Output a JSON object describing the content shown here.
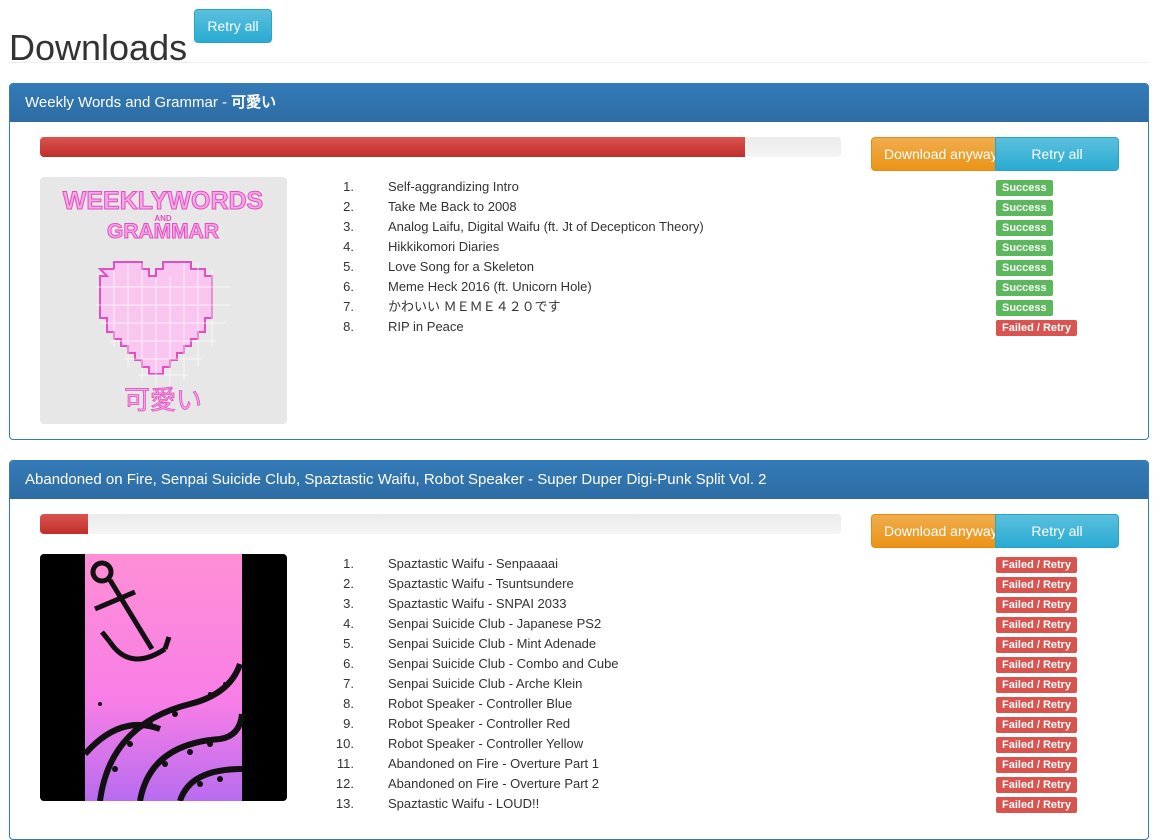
{
  "page": {
    "title": "Downloads",
    "retry_all_label": "Retry all"
  },
  "colors": {
    "primary": "#337ab7",
    "success": "#5cb85c",
    "danger": "#d9534f",
    "warning": "#f0ad4e",
    "info": "#5bc0de"
  },
  "albums": [
    {
      "heading_prefix": "Weekly Words and Grammar - ",
      "heading_suffix": "可愛い",
      "progress_percent": 88,
      "download_anyway_label": "Download anyway",
      "retry_all_label": "Retry all",
      "cover_text_top": "WEEKLYWORDS",
      "cover_text_and": "AND",
      "cover_text_mid": "GRAMMAR",
      "cover_text_bottom": "可愛い",
      "tracks": [
        {
          "num": "1.",
          "title": "Self-aggrandizing Intro",
          "status": "Success"
        },
        {
          "num": "2.",
          "title": "Take Me Back to 2008",
          "status": "Success"
        },
        {
          "num": "3.",
          "title": "Analog Laifu, Digital Waifu (ft. Jt of Decepticon Theory)",
          "status": "Success"
        },
        {
          "num": "4.",
          "title": "Hikkikomori Diaries",
          "status": "Success"
        },
        {
          "num": "5.",
          "title": "Love Song for a Skeleton",
          "status": "Success"
        },
        {
          "num": "6.",
          "title": "Meme Heck 2016 (ft. Unicorn Hole)",
          "status": "Success"
        },
        {
          "num": "7.",
          "title": "かわいい ＭＥＭＥ４２０です",
          "status": "Success"
        },
        {
          "num": "8.",
          "title": "RIP in Peace",
          "status": "Failed / Retry"
        }
      ]
    },
    {
      "heading_prefix": "Abandoned on Fire, Senpai Suicide Club, Spaztastic Waifu, Robot Speaker - Super Duper Digi-Punk Split Vol. 2",
      "heading_suffix": "",
      "progress_percent": 6,
      "download_anyway_label": "Download anyway",
      "retry_all_label": "Retry all",
      "tracks": [
        {
          "num": "1.",
          "title": "Spaztastic Waifu - Senpaaaai",
          "status": "Failed / Retry"
        },
        {
          "num": "2.",
          "title": "Spaztastic Waifu - Tsuntsundere",
          "status": "Failed / Retry"
        },
        {
          "num": "3.",
          "title": "Spaztastic Waifu - SNPAI 2033",
          "status": "Failed / Retry"
        },
        {
          "num": "4.",
          "title": "Senpai Suicide Club - Japanese PS2",
          "status": "Failed / Retry"
        },
        {
          "num": "5.",
          "title": "Senpai Suicide Club - Mint Adenade",
          "status": "Failed / Retry"
        },
        {
          "num": "6.",
          "title": "Senpai Suicide Club - Combo and Cube",
          "status": "Failed / Retry"
        },
        {
          "num": "7.",
          "title": "Senpai Suicide Club - Arche Klein",
          "status": "Failed / Retry"
        },
        {
          "num": "8.",
          "title": "Robot Speaker - Controller Blue",
          "status": "Failed / Retry"
        },
        {
          "num": "9.",
          "title": "Robot Speaker - Controller Red",
          "status": "Failed / Retry"
        },
        {
          "num": "10.",
          "title": "Robot Speaker - Controller Yellow",
          "status": "Failed / Retry"
        },
        {
          "num": "11.",
          "title": "Abandoned on Fire - Overture Part 1",
          "status": "Failed / Retry"
        },
        {
          "num": "12.",
          "title": "Abandoned on Fire - Overture Part 2",
          "status": "Failed / Retry"
        },
        {
          "num": "13.",
          "title": "Spaztastic Waifu - LOUD!!",
          "status": "Failed / Retry"
        }
      ]
    }
  ]
}
